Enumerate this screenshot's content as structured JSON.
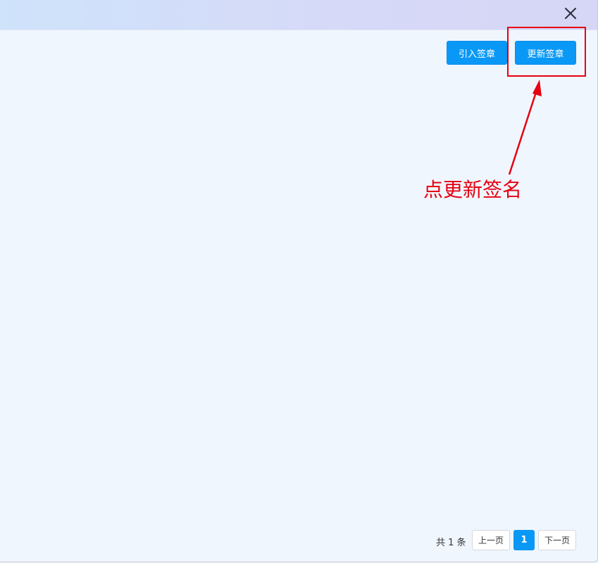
{
  "dialog": {
    "close_icon": "close-icon",
    "toolbar": {
      "import_label": "引入签章",
      "update_label": "更新签章"
    }
  },
  "annotation": {
    "text": "点更新签名",
    "color": "#e60012"
  },
  "pagination": {
    "total": "共 1 条",
    "prev_label": "上一页",
    "current_page": "1",
    "next_label": "下一页"
  },
  "colors": {
    "primary": "#0a98f6",
    "highlight": "#e60012"
  }
}
